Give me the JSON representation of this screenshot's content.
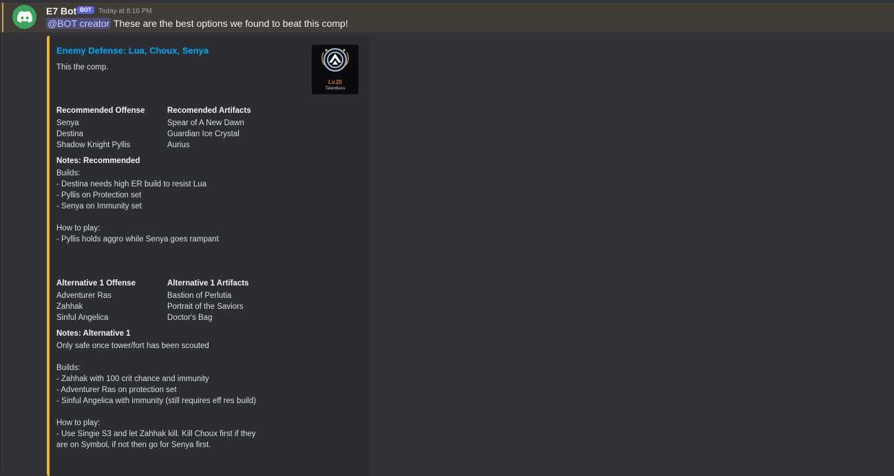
{
  "message": {
    "username": "E7 Bot",
    "bot_tag": "BOT",
    "timestamp": "Today at 8:16 PM",
    "mention": "@BOT creator",
    "text": " These are the best options we found to beat this comp!"
  },
  "embed": {
    "title": "Enemy Defense:  Lua, Choux, Senya",
    "description": "This the comp.",
    "thumbnail": {
      "level": "Lv.20",
      "caption": "Talentless"
    },
    "recommended": {
      "offense_title": "Recommended Offense",
      "offense": [
        "Senya",
        "Destina",
        "Shadow Knight Pyllis"
      ],
      "artifacts_title": "Recomended Artifacts",
      "artifacts": [
        "Spear of A New Dawn",
        "Guardian Ice Crystal",
        "Aurius"
      ],
      "notes_title": "Notes: Recommended",
      "notes": [
        "Builds:",
        "- Destina needs high ER build to resist Lua",
        "- Pyllis on Protection set",
        "- Senya on Immunity set",
        "",
        "How to play:",
        "- Pyllis holds aggro while Senya goes rampant"
      ]
    },
    "alternative1": {
      "offense_title": "Alternative 1 Offense",
      "offense": [
        "Adventurer Ras",
        "Zahhak",
        "Sinful Angelica"
      ],
      "artifacts_title": "Alternative 1 Artifacts",
      "artifacts": [
        "Bastion of Perlutia",
        "Portrait of the Saviors",
        "Doctor's Bag"
      ],
      "notes_title": "Notes: Alternative 1",
      "notes": [
        "Only safe once tower/fort has been scouted",
        "",
        "Builds:",
        "- Zahhak with 100 crit chance and immunity",
        "- Adventurer Ras on protection set",
        "- Sinful Angelica with immunity (still requires eff res build)",
        "",
        "How to play:",
        "- Use Singie S3 and let Zahhak kill. Kill Choux first if they",
        "are on Symbol, if not then go for Senya first."
      ]
    }
  },
  "icons": {
    "avatar": "discord-logo-icon",
    "thumbnail": "guild-emblem-icon"
  },
  "colors": {
    "accent": "#e8b930",
    "title_link": "#00a8fc",
    "avatar_bg": "#3ba55c"
  }
}
